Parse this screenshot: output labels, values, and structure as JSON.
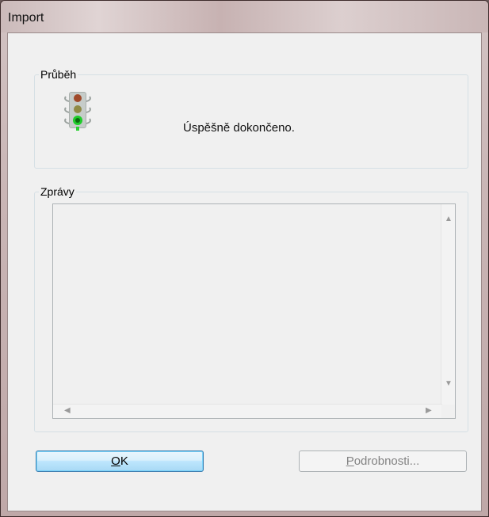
{
  "window": {
    "title": "Import"
  },
  "progress": {
    "group_label": "Průběh",
    "status_text": "Úspěšně dokončeno.",
    "icon": "traffic-light-icon"
  },
  "messages": {
    "group_label": "Zprávy"
  },
  "buttons": {
    "ok": {
      "accel": "O",
      "rest": "K"
    },
    "details": {
      "accel": "P",
      "rest": "odrobnosti..."
    }
  }
}
